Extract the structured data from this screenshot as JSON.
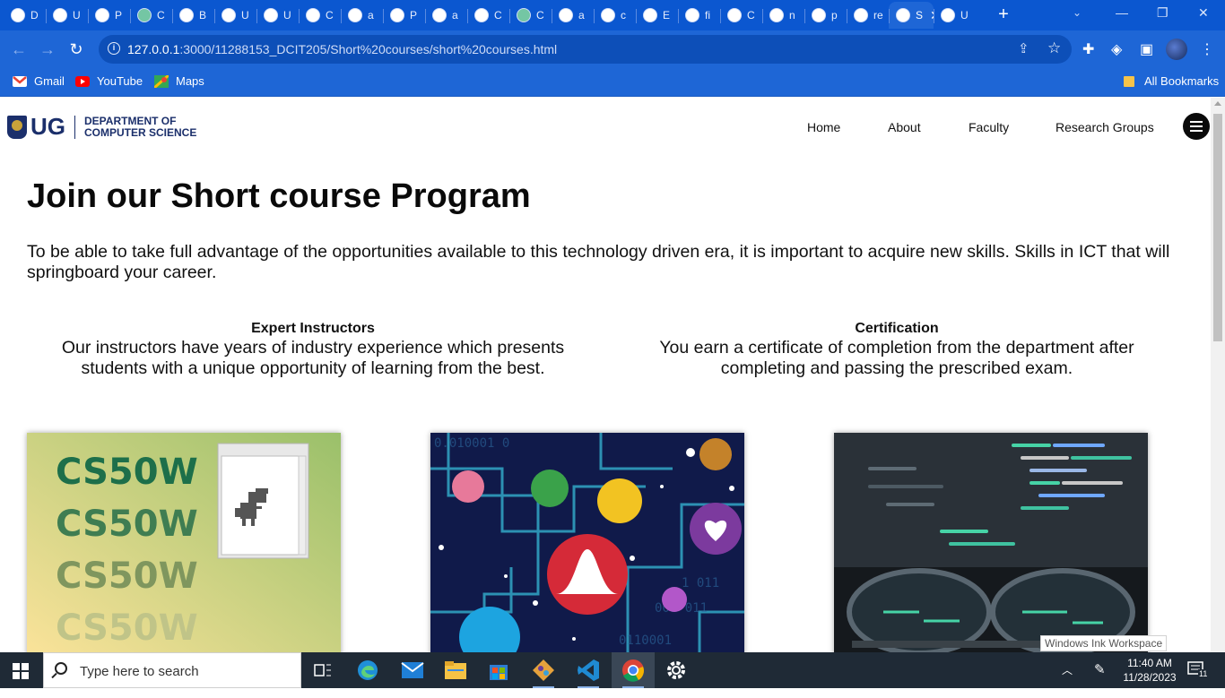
{
  "browser": {
    "tabs": [
      {
        "favicon": "docs-icon",
        "label": "D",
        "color": "#ffffff"
      },
      {
        "favicon": "loading-icon",
        "label": "U",
        "color": "#ffffff"
      },
      {
        "favicon": "loading-icon",
        "label": "P",
        "color": "#ffffff"
      },
      {
        "favicon": "chatgpt-icon",
        "label": "C",
        "color": "#74c6a4"
      },
      {
        "favicon": "badge-icon",
        "label": "B",
        "color": "#ffffff"
      },
      {
        "favicon": "crest-icon",
        "label": "U",
        "color": "#ffffff"
      },
      {
        "favicon": "crest-icon",
        "label": "U",
        "color": "#ffffff"
      },
      {
        "favicon": "app-icon",
        "label": "C",
        "color": "#ffffff"
      },
      {
        "favicon": "github-icon",
        "label": "a",
        "color": "#ffffff"
      },
      {
        "favicon": "github-icon",
        "label": "P",
        "color": "#ffffff"
      },
      {
        "favicon": "github-icon",
        "label": "a",
        "color": "#ffffff"
      },
      {
        "favicon": "gear-icon",
        "label": "C",
        "color": "#ffffff"
      },
      {
        "favicon": "chatgpt-icon",
        "label": "C",
        "color": "#74c6a4"
      },
      {
        "favicon": "globe-icon",
        "label": "a",
        "color": "#ffffff"
      },
      {
        "favicon": "globe-icon",
        "label": "c",
        "color": "#ffffff"
      },
      {
        "favicon": "globe-icon",
        "label": "E",
        "color": "#ffffff"
      },
      {
        "favicon": "globe-icon",
        "label": "fi",
        "color": "#ffffff"
      },
      {
        "favicon": "globe-icon",
        "label": "C",
        "color": "#ffffff"
      },
      {
        "favicon": "globe-icon",
        "label": "n",
        "color": "#ffffff"
      },
      {
        "favicon": "globe-icon",
        "label": "p",
        "color": "#ffffff"
      },
      {
        "favicon": "globe-icon",
        "label": "re",
        "color": "#ffffff"
      }
    ],
    "active_tab": {
      "label": "S",
      "close": "✕"
    },
    "after_tab": {
      "favicon": "globe-icon",
      "label": "U"
    },
    "new_tab": "+",
    "url_host": "127.0.0.1",
    "url_rest": ":3000/11288153_DCIT205/Short%20courses/short%20courses.html",
    "bookmarks": [
      {
        "icon": "gmail-icon",
        "label": "Gmail"
      },
      {
        "icon": "youtube-icon",
        "label": "YouTube"
      },
      {
        "icon": "maps-icon",
        "label": "Maps"
      }
    ],
    "all_bookmarks": "All Bookmarks"
  },
  "site": {
    "logo_ug": "UG",
    "logo_line1": "DEPARTMENT OF",
    "logo_line2": "COMPUTER SCIENCE",
    "nav": [
      "Home",
      "About",
      "Faculty",
      "Research Groups"
    ],
    "title": "Join our Short course Program",
    "intro": "To be able to take full advantage of the opportunities available to this technology driven era, it is important to acquire new skills. Skills in ICT that will springboard your career.",
    "features": [
      {
        "heading": "Expert Instructors",
        "line1": "Our instructors have years of industry experience which presents",
        "line2": "students with a unique opportunity of learning from the best."
      },
      {
        "heading": "Certification",
        "line1": "You earn a certificate of completion from the department after",
        "line2": "completing and passing the prescribed exam."
      }
    ],
    "cards": [
      {
        "image": "cs50w-image",
        "lines": [
          "CS50W",
          "CS50W",
          "CS50W",
          "CS50W"
        ]
      },
      {
        "image": "health-data-image"
      },
      {
        "image": "code-glasses-image"
      }
    ]
  },
  "taskbar": {
    "search_placeholder": "Type here to search",
    "time": "11:40 AM",
    "date": "11/28/2023",
    "notifications": "11",
    "ink_workspace": "Windows Ink Workspace"
  }
}
